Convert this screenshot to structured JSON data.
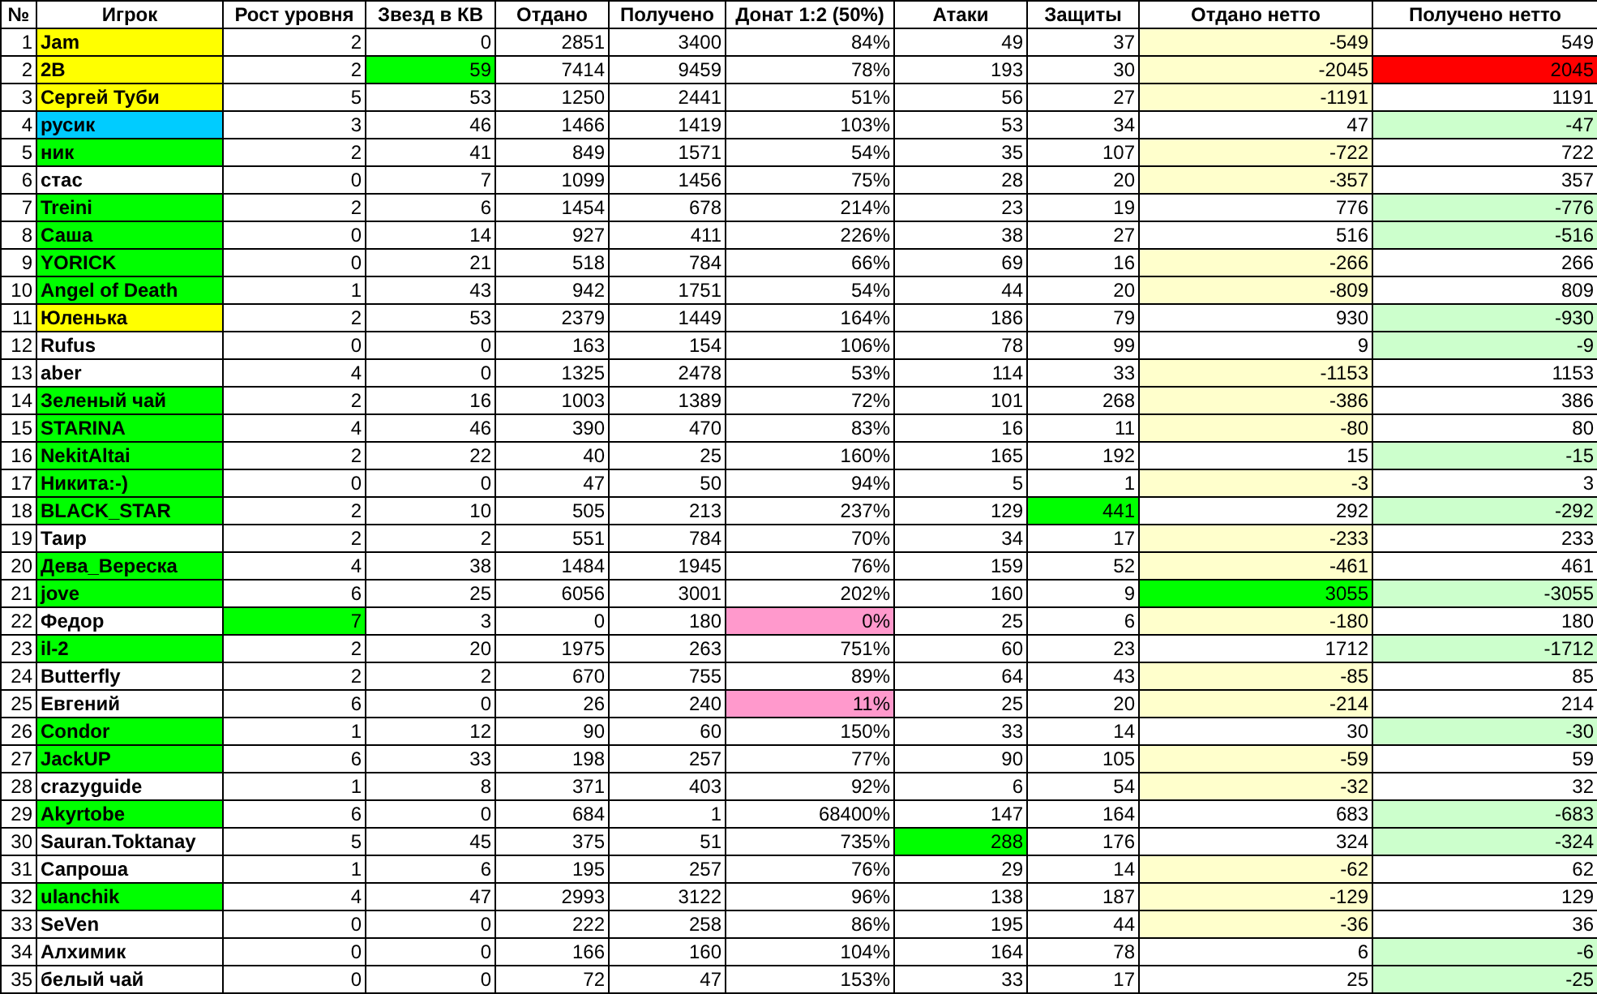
{
  "table": {
    "columns": [
      "№",
      "Игрок",
      "Рост уровня",
      "Звезд в КВ",
      "Отдано",
      "Получено",
      "Донат 1:2 (50%)",
      "Атаки",
      "Защиты",
      "Отдано нетто",
      "Получено нетто"
    ],
    "rows": [
      {
        "cells": [
          "1",
          {
            "text": "Jam",
            "color": "#ffff00"
          },
          "2",
          "0",
          "2851",
          "3400",
          "84%",
          "49",
          "37",
          {
            "text": "-549",
            "color": "#ffffcc"
          },
          "549"
        ]
      },
      {
        "cells": [
          "2",
          {
            "text": "2B",
            "color": "#ffff00"
          },
          "2",
          {
            "text": "59",
            "color": "#00ff00"
          },
          "7414",
          "9459",
          "78%",
          "193",
          "30",
          {
            "text": "-2045",
            "color": "#ffffcc"
          },
          {
            "text": "2045",
            "color": "#ff0000"
          }
        ]
      },
      {
        "cells": [
          "3",
          {
            "text": "Сергей Туби",
            "color": "#ffff00"
          },
          "5",
          "53",
          "1250",
          "2441",
          "51%",
          "56",
          "27",
          {
            "text": "-1191",
            "color": "#ffffcc"
          },
          "1191"
        ]
      },
      {
        "cells": [
          "4",
          {
            "text": "русик",
            "color": "#00ccff"
          },
          "3",
          "46",
          "1466",
          "1419",
          "103%",
          "53",
          "34",
          "47",
          {
            "text": "-47",
            "color": "#ccffcc"
          }
        ]
      },
      {
        "cells": [
          "5",
          {
            "text": "ник",
            "color": "#00ff00"
          },
          "2",
          "41",
          "849",
          "1571",
          "54%",
          "35",
          "107",
          {
            "text": "-722",
            "color": "#ffffcc"
          },
          "722"
        ]
      },
      {
        "cells": [
          "6",
          "стас",
          "0",
          "7",
          "1099",
          "1456",
          "75%",
          "28",
          "20",
          {
            "text": "-357",
            "color": "#ffffcc"
          },
          "357"
        ]
      },
      {
        "cells": [
          "7",
          {
            "text": "Treini",
            "color": "#00ff00"
          },
          "2",
          "6",
          "1454",
          "678",
          "214%",
          "23",
          "19",
          "776",
          {
            "text": "-776",
            "color": "#ccffcc"
          }
        ]
      },
      {
        "cells": [
          "8",
          {
            "text": "Саша",
            "color": "#00ff00"
          },
          "0",
          "14",
          "927",
          "411",
          "226%",
          "38",
          "27",
          "516",
          {
            "text": "-516",
            "color": "#ccffcc"
          }
        ]
      },
      {
        "cells": [
          "9",
          {
            "text": "YORICK",
            "color": "#00ff00"
          },
          "0",
          "21",
          "518",
          "784",
          "66%",
          "69",
          "16",
          {
            "text": "-266",
            "color": "#ffffcc"
          },
          "266"
        ]
      },
      {
        "cells": [
          "10",
          {
            "text": "Angel of Death",
            "color": "#00ff00"
          },
          "1",
          "43",
          "942",
          "1751",
          "54%",
          "44",
          "20",
          {
            "text": "-809",
            "color": "#ffffcc"
          },
          "809"
        ]
      },
      {
        "cells": [
          "11",
          {
            "text": "Юленька",
            "color": "#ffff00"
          },
          "2",
          "53",
          "2379",
          "1449",
          "164%",
          "186",
          "79",
          "930",
          {
            "text": "-930",
            "color": "#ccffcc"
          }
        ]
      },
      {
        "cells": [
          "12",
          "Rufus",
          "0",
          "0",
          "163",
          "154",
          "106%",
          "78",
          "99",
          "9",
          {
            "text": "-9",
            "color": "#ccffcc"
          }
        ]
      },
      {
        "cells": [
          "13",
          "aber",
          "4",
          "0",
          "1325",
          "2478",
          "53%",
          "114",
          "33",
          {
            "text": "-1153",
            "color": "#ffffcc"
          },
          "1153"
        ]
      },
      {
        "cells": [
          "14",
          {
            "text": "Зеленый чай",
            "color": "#00ff00"
          },
          "2",
          "16",
          "1003",
          "1389",
          "72%",
          "101",
          "268",
          {
            "text": "-386",
            "color": "#ffffcc"
          },
          "386"
        ]
      },
      {
        "cells": [
          "15",
          {
            "text": "STARINA",
            "color": "#00ff00"
          },
          "4",
          "46",
          "390",
          "470",
          "83%",
          "16",
          "11",
          {
            "text": "-80",
            "color": "#ffffcc"
          },
          "80"
        ]
      },
      {
        "cells": [
          "16",
          {
            "text": "NekitAltai",
            "color": "#00ff00"
          },
          "2",
          "22",
          "40",
          "25",
          "160%",
          "165",
          "192",
          "15",
          {
            "text": "-15",
            "color": "#ccffcc"
          }
        ]
      },
      {
        "cells": [
          "17",
          {
            "text": "Никита:-)",
            "color": "#00ff00"
          },
          "0",
          "0",
          "47",
          "50",
          "94%",
          "5",
          "1",
          {
            "text": "-3",
            "color": "#ffffcc"
          },
          "3"
        ]
      },
      {
        "cells": [
          "18",
          {
            "text": "BLACK_STAR",
            "color": "#00ff00"
          },
          "2",
          "10",
          "505",
          "213",
          "237%",
          "129",
          {
            "text": "441",
            "color": "#00ff00"
          },
          "292",
          {
            "text": "-292",
            "color": "#ccffcc"
          }
        ]
      },
      {
        "cells": [
          "19",
          "Таир",
          "2",
          "2",
          "551",
          "784",
          "70%",
          "34",
          "17",
          {
            "text": "-233",
            "color": "#ffffcc"
          },
          "233"
        ]
      },
      {
        "cells": [
          "20",
          {
            "text": "Дева_Вереска",
            "color": "#00ff00"
          },
          "4",
          "38",
          "1484",
          "1945",
          "76%",
          "159",
          "52",
          {
            "text": "-461",
            "color": "#ffffcc"
          },
          "461"
        ]
      },
      {
        "cells": [
          "21",
          {
            "text": "jove",
            "color": "#00ff00"
          },
          "6",
          "25",
          "6056",
          "3001",
          "202%",
          "160",
          "9",
          {
            "text": "3055",
            "color": "#00ff00"
          },
          {
            "text": "-3055",
            "color": "#ccffcc"
          }
        ]
      },
      {
        "cells": [
          "22",
          "Федор",
          {
            "text": "7",
            "color": "#00ff00"
          },
          "3",
          "0",
          "180",
          {
            "text": "0%",
            "color": "#ff99cc"
          },
          "25",
          "6",
          {
            "text": "-180",
            "color": "#ffffcc"
          },
          "180"
        ]
      },
      {
        "cells": [
          "23",
          {
            "text": "il-2",
            "color": "#00ff00"
          },
          "2",
          "20",
          "1975",
          "263",
          "751%",
          "60",
          "23",
          "1712",
          {
            "text": "-1712",
            "color": "#ccffcc"
          }
        ]
      },
      {
        "cells": [
          "24",
          "Butterfly",
          "2",
          "2",
          "670",
          "755",
          "89%",
          "64",
          "43",
          {
            "text": "-85",
            "color": "#ffffcc"
          },
          "85"
        ]
      },
      {
        "cells": [
          "25",
          "Евгений",
          "6",
          "0",
          "26",
          "240",
          {
            "text": "11%",
            "color": "#ff99cc"
          },
          "25",
          "20",
          {
            "text": "-214",
            "color": "#ffffcc"
          },
          "214"
        ]
      },
      {
        "cells": [
          "26",
          {
            "text": "Condor",
            "color": "#00ff00"
          },
          "1",
          "12",
          "90",
          "60",
          "150%",
          "33",
          "14",
          "30",
          {
            "text": "-30",
            "color": "#ccffcc"
          }
        ]
      },
      {
        "cells": [
          "27",
          {
            "text": "JackUP",
            "color": "#00ff00"
          },
          "6",
          "33",
          "198",
          "257",
          "77%",
          "90",
          "105",
          {
            "text": "-59",
            "color": "#ffffcc"
          },
          "59"
        ]
      },
      {
        "cells": [
          "28",
          "crazyguide",
          "1",
          "8",
          "371",
          "403",
          "92%",
          "6",
          "54",
          {
            "text": "-32",
            "color": "#ffffcc"
          },
          "32"
        ]
      },
      {
        "cells": [
          "29",
          {
            "text": "Akyrtobe",
            "color": "#00ff00"
          },
          "6",
          "0",
          "684",
          "1",
          "68400%",
          "147",
          "164",
          "683",
          {
            "text": "-683",
            "color": "#ccffcc"
          }
        ]
      },
      {
        "cells": [
          "30",
          "Sauran.Toktanay",
          "5",
          "45",
          "375",
          "51",
          "735%",
          {
            "text": "288",
            "color": "#00ff00"
          },
          "176",
          "324",
          {
            "text": "-324",
            "color": "#ccffcc"
          }
        ]
      },
      {
        "cells": [
          "31",
          "Сапроша",
          "1",
          "6",
          "195",
          "257",
          "76%",
          "29",
          "14",
          {
            "text": "-62",
            "color": "#ffffcc"
          },
          "62"
        ]
      },
      {
        "cells": [
          "32",
          {
            "text": "ulanchik",
            "color": "#00ff00"
          },
          "4",
          "47",
          "2993",
          "3122",
          "96%",
          "138",
          "187",
          {
            "text": "-129",
            "color": "#ffffcc"
          },
          "129"
        ]
      },
      {
        "cells": [
          "33",
          "SeVen",
          "0",
          "0",
          "222",
          "258",
          "86%",
          "195",
          "44",
          {
            "text": "-36",
            "color": "#ffffcc"
          },
          "36"
        ]
      },
      {
        "cells": [
          "34",
          "Алхимик",
          "0",
          "0",
          "166",
          "160",
          "104%",
          "164",
          "78",
          "6",
          {
            "text": "-6",
            "color": "#ccffcc"
          }
        ]
      },
      {
        "cells": [
          "35",
          "белый чай",
          "0",
          "0",
          "72",
          "47",
          "153%",
          "33",
          "17",
          "25",
          {
            "text": "-25",
            "color": "#ccffcc"
          }
        ]
      }
    ]
  }
}
